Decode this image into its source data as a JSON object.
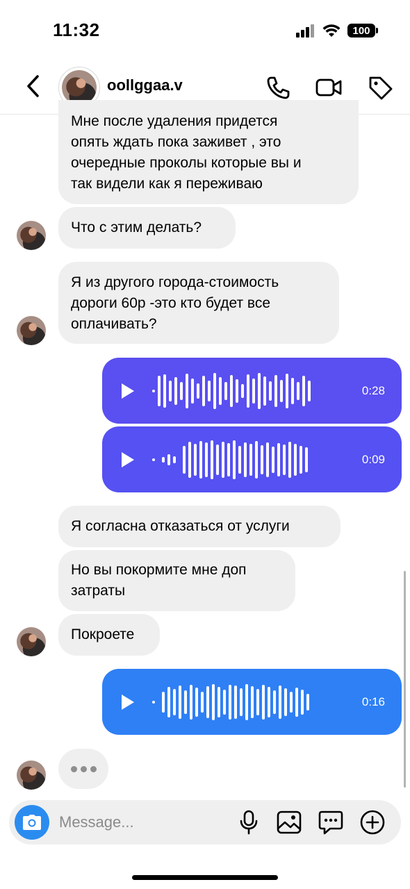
{
  "status_bar": {
    "time": "11:32",
    "battery": "100",
    "icons": [
      "signal-icon",
      "wifi-icon",
      "battery-icon"
    ]
  },
  "header": {
    "username": "oollggaa.v",
    "icons": [
      "back-chevron-icon",
      "phone-icon",
      "video-camera-icon",
      "tag-icon"
    ]
  },
  "messages": [
    {
      "type": "text",
      "from": "contact",
      "text": "Мне после удаления придется\nопять ждать пока заживет , это\nочередные проколы которые вы и\nтак видели как я переживаю"
    },
    {
      "type": "text",
      "from": "contact",
      "text": "Что с этим делать?"
    },
    {
      "type": "text",
      "from": "contact",
      "text": "Я из другого города-стоимость\nдороги 60р -это кто будет все\nоплачивать?"
    },
    {
      "type": "voice",
      "from": "me",
      "duration": "0:28"
    },
    {
      "type": "voice",
      "from": "me",
      "duration": "0:09"
    },
    {
      "type": "text",
      "from": "contact",
      "text": "Я согласна отказаться от услуги"
    },
    {
      "type": "text",
      "from": "contact",
      "text": "Но вы покормите мне доп\nзатраты"
    },
    {
      "type": "text",
      "from": "contact",
      "text": "Покроете"
    },
    {
      "type": "voice",
      "from": "me",
      "duration": "0:16"
    },
    {
      "type": "typing",
      "from": "contact"
    }
  ],
  "composer": {
    "placeholder": "Message...",
    "icons": [
      "camera-icon",
      "microphone-icon",
      "gallery-icon",
      "sticker-icon",
      "plus-icon"
    ]
  },
  "colors": {
    "incoming_bubble": "#efefef",
    "voice_1": "#5a4ff0",
    "voice_2": "#5551f2",
    "voice_3": "#2f80f5",
    "camera_button": "#2b8cf0"
  }
}
